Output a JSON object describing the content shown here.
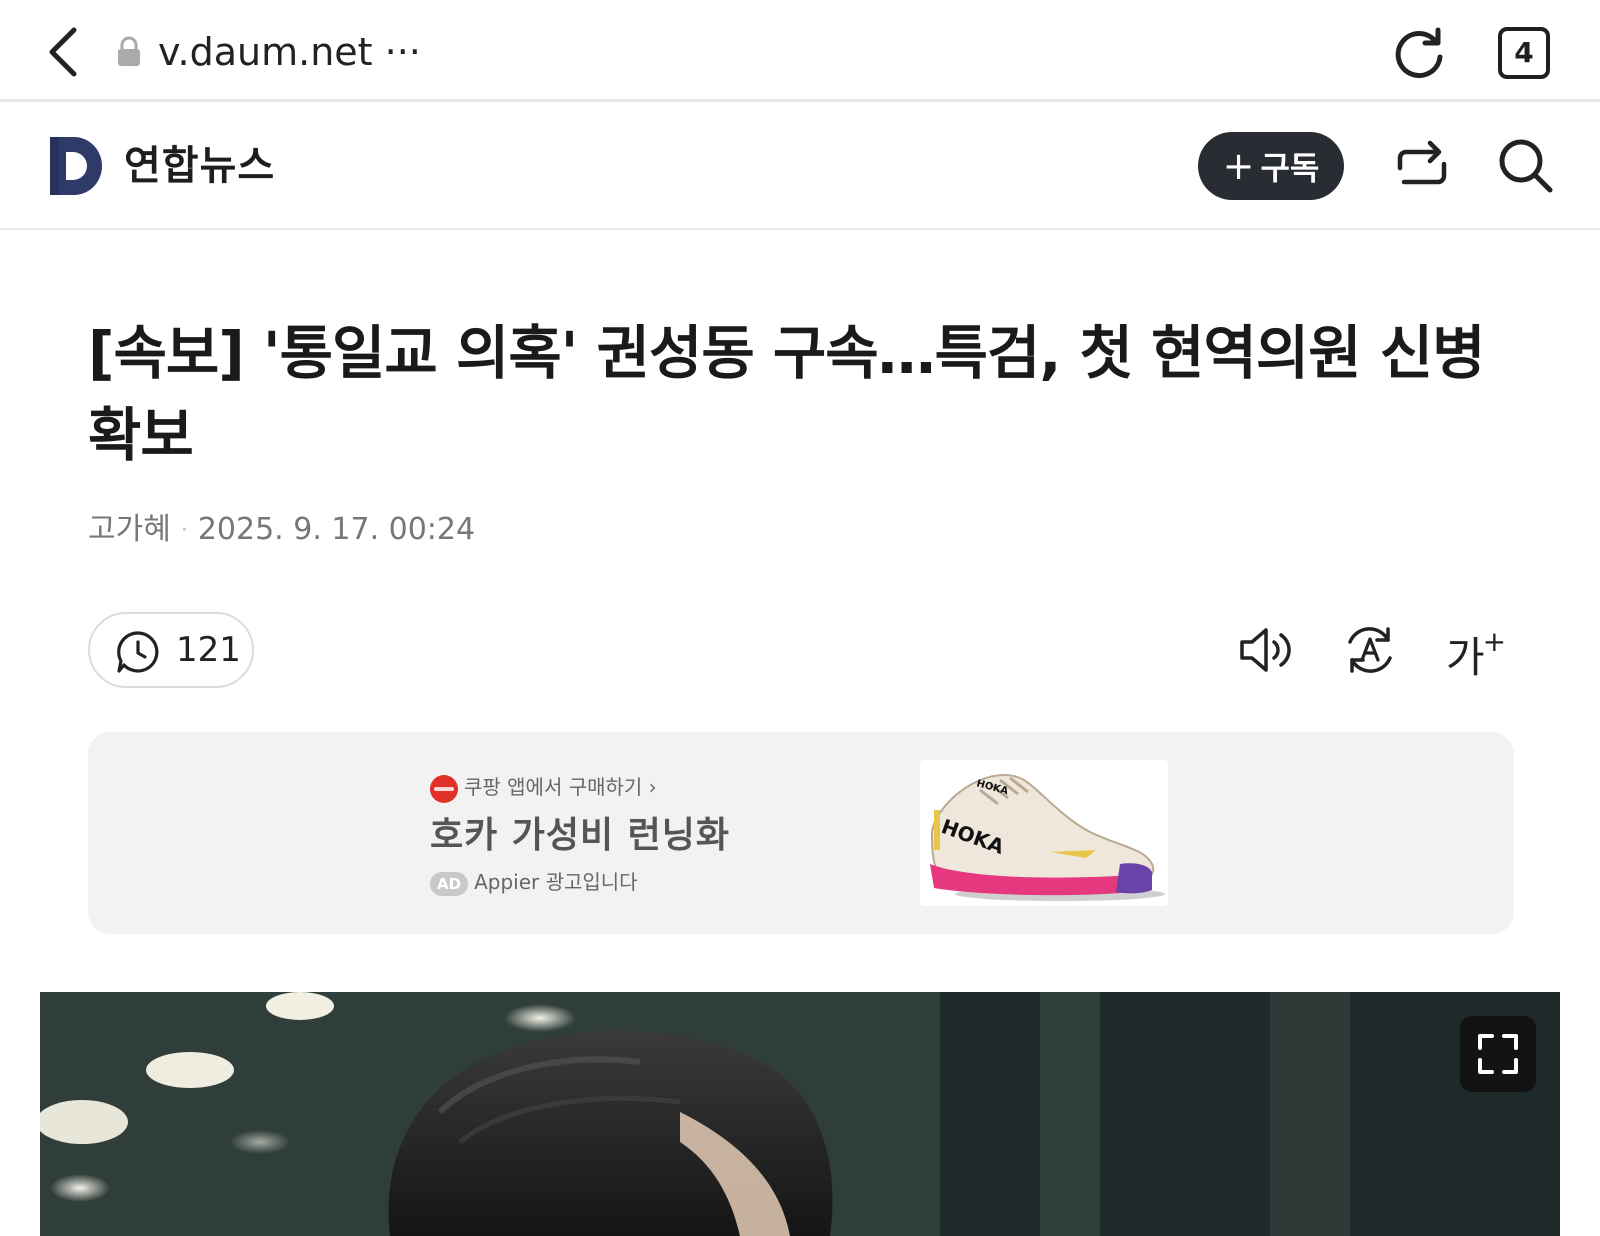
{
  "browser": {
    "url": "v.daum.net ···",
    "tab_count": "4"
  },
  "header": {
    "press_name": "연합뉴스",
    "subscribe_label": "구독",
    "subscribe_plus": "+"
  },
  "article": {
    "headline": "[속보] '통일교 의혹' 권성동 구속…특검, 첫 현역의원 신병 확보",
    "author": "고가혜",
    "meta_separator": "·",
    "datetime": "2025. 9. 17. 00:24",
    "comment_count": "121",
    "font_size_label": "가",
    "font_size_sup": "+"
  },
  "ad": {
    "source": "쿠팡 앱에서 구매하기 ›",
    "title": "호카 가성비 런닝화",
    "badge": "AD",
    "label": "Appier 광고입니다",
    "image_brand": "HOKA"
  },
  "colors": {
    "subscribe_bg": "#292d33",
    "ad_bg": "#f2f2f2",
    "coupang_red": "#e0312a",
    "shoe_pink": "#e6387e"
  },
  "icons": {
    "back": "chevron-left-icon",
    "lock": "lock-icon",
    "reload": "reload-icon",
    "share": "share-icon",
    "search": "search-icon",
    "comment": "comment-icon",
    "audio": "speaker-icon",
    "translate": "translate-icon",
    "expand": "expand-icon"
  }
}
